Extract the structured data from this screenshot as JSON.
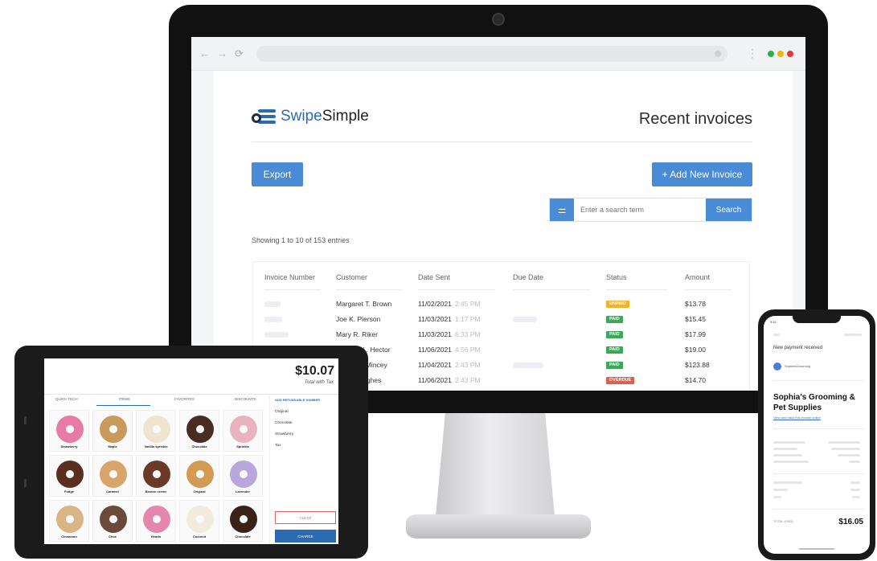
{
  "browser": {
    "nav_icons": [
      "←",
      "→",
      "⟳"
    ],
    "menu_glyph": "⋮",
    "window_dots": [
      "#2bb24c",
      "#f5b700",
      "#e53935"
    ]
  },
  "app": {
    "brand_part1": "Swipe",
    "brand_part2": "Simple",
    "page_title": "Recent invoices",
    "export_label": "Export",
    "add_invoice_label": "+  Add New Invoice",
    "search_filter_glyph": "⚌",
    "search_placeholder": "Enter a search term",
    "search_button": "Search",
    "entries_text": "Showing 1 to 10 of 153 entries",
    "accent_color": "#4a8bd6"
  },
  "invoices": {
    "headers": [
      "Invoice Number",
      "Customer",
      "Date Sent",
      "Due Date",
      "Status",
      "Amount"
    ],
    "rows": [
      {
        "customer": "Margaret T. Brown",
        "date": "11/02/2021",
        "time": "2:45 PM",
        "status": "UNPAID",
        "status_color": "#f0b429",
        "amount": "$13.78"
      },
      {
        "customer": "Joe K. Pierson",
        "date": "11/03/2021",
        "time": "1:17 PM",
        "status": "PAID",
        "status_color": "#3aa856",
        "amount": "$15.45"
      },
      {
        "customer": "Mary R. Riker",
        "date": "11/03/2021",
        "time": "6:33 PM",
        "status": "PAID",
        "status_color": "#3aa856",
        "amount": "$17.99"
      },
      {
        "customer": "Thomas L. Hector",
        "date": "11/06/2021",
        "time": "4:56 PM",
        "status": "PAID",
        "status_color": "#3aa856",
        "amount": "$19.00"
      },
      {
        "customer": "Sarah M. Mincey",
        "date": "11/04/2021",
        "time": "2:43 PM",
        "status": "PAID",
        "status_color": "#3aa856",
        "amount": "$123.88"
      },
      {
        "customer": "Jim O. Hughes",
        "date": "11/06/2021",
        "time": "2:43 PM",
        "status": "OVERDUE",
        "status_color": "#e05d4f",
        "amount": "$14.70"
      }
    ]
  },
  "pos": {
    "total": "$10.07",
    "total_sub": "Total with Tax",
    "tabs": [
      "QUICK TECH",
      "ITEMS",
      "FAVORITES",
      "DISCOUNTS"
    ],
    "items": [
      {
        "name": "Strawberry",
        "color": "#e87aa6"
      },
      {
        "name": "Maple",
        "color": "#c99b5a"
      },
      {
        "name": "Vanilla sprinkle",
        "color": "#efe4d0"
      },
      {
        "name": "Chocolate",
        "color": "#4a2c22"
      },
      {
        "name": "Sprinkle",
        "color": "#e9b4c2"
      },
      {
        "name": "Fudge",
        "color": "#5a2f20"
      },
      {
        "name": "Caramel",
        "color": "#d9a46a"
      },
      {
        "name": "Boston creme",
        "color": "#6b3a26"
      },
      {
        "name": "Original",
        "color": "#d39a52"
      },
      {
        "name": "Lavender",
        "color": "#b9a6dc"
      },
      {
        "name": "Cinnamon",
        "color": "#d8b487"
      },
      {
        "name": "Choc",
        "color": "#6a4a3a"
      },
      {
        "name": "Hearts",
        "color": "#e586ac"
      },
      {
        "name": "Coconut",
        "color": "#f1ebe0"
      },
      {
        "name": "Chocolate",
        "color": "#3a221b"
      }
    ],
    "modifier_link": "ADD REFUNDABLE NUMBER",
    "modifiers": [
      "Original",
      "Chocolate",
      "Strawberry",
      "Tax"
    ],
    "clear_label": "CLEAR",
    "charge_label": "CHARGE"
  },
  "phone": {
    "status_time": "9:41",
    "subject": "New payment received",
    "sender": "SophiesGrooming",
    "business_name": "Sophia's Grooming & Pet Supplies",
    "link_text": "View and track this invoice online",
    "total_label": "TOTAL (USD)",
    "total": "$16.05"
  }
}
